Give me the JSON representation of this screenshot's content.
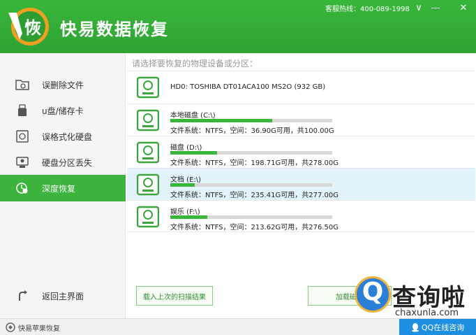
{
  "app": {
    "logo_char": "恢",
    "title": "快易数据恢复",
    "hotline": "客服热线：400-089-1998"
  },
  "window": {
    "minimize": "∨",
    "restore": "—",
    "close": "✕"
  },
  "sidebar": {
    "items": [
      {
        "label": "误删除文件",
        "icon": "folder-icon"
      },
      {
        "label": "u盘/储存卡",
        "icon": "usb-icon"
      },
      {
        "label": "误格式化硬盘",
        "icon": "format-disk-icon"
      },
      {
        "label": "硬盘分区丢失",
        "icon": "partition-icon"
      },
      {
        "label": "深度恢复",
        "icon": "deep-recovery-icon",
        "active": true
      }
    ],
    "back": {
      "label": "返回主界面",
      "icon": "back-arrow-icon"
    }
  },
  "main": {
    "prompt": "请选择要恢复的物理设备或分区：",
    "physical_disk": "HD0: TOSHIBA DT01ACA100 MS2O (932 GB)",
    "partitions": [
      {
        "name": "本地磁盘 (C:\\)",
        "info": "文件系统：NTFS，空间：36.90G可用，共100.00G",
        "used": 0.63
      },
      {
        "name": "磁盘 (D:\\)",
        "info": "文件系统：NTFS，空间：198.71G可用，共278.00G",
        "used": 0.29
      },
      {
        "name": "文档 (E:\\)",
        "info": "文件系统：NTFS，空间：235.41G可用，共277.00G",
        "used": 0.15,
        "selected": true
      },
      {
        "name": "娱乐 (F:\\)",
        "info": "文件系统：NTFS，空间：213.62G可用，共276.50G",
        "used": 0.23
      }
    ],
    "load_button": "载入上次的扫描结果",
    "scan_button": "加载磁盘"
  },
  "watermark": {
    "letter": "Q",
    "text": "查询啦",
    "url": "chaxunla.com"
  },
  "statusbar": {
    "brand": "快易苹果恢复",
    "qq_button": "QQ在线咨询"
  },
  "colors": {
    "accent": "#38b63a",
    "selected_row": "#e3f3fb",
    "qq_blue": "#1e8ee0"
  }
}
